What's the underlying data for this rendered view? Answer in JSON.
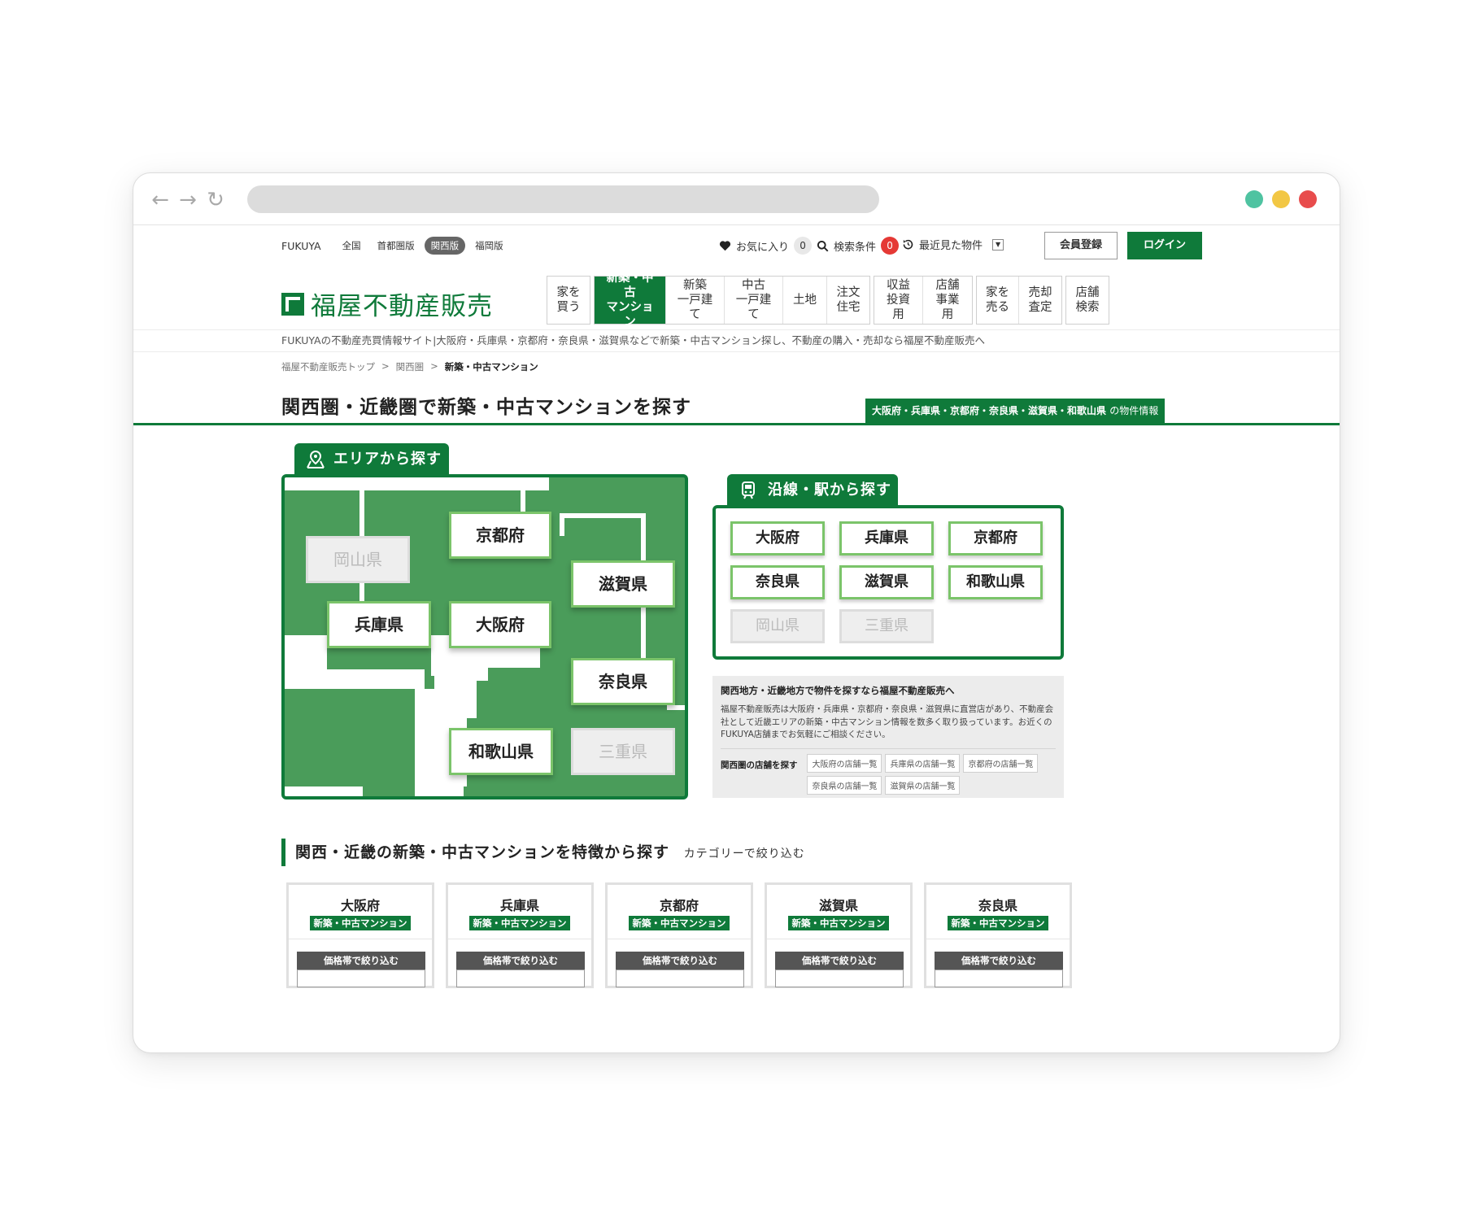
{
  "colors": {
    "brand_green": "#0f7a3a",
    "map_green": "#4a9c5a",
    "button_border": "#7bc46a"
  },
  "browser": {
    "back_icon": "←",
    "forward_icon": "→",
    "reload_icon": "↻",
    "dots": [
      "#4fc3a1",
      "#f2c744",
      "#e84c4c"
    ]
  },
  "topbar": {
    "brand": "FUKUYA",
    "editions": [
      "全国",
      "首都圏版",
      "関西版",
      "福岡版"
    ],
    "favorites_label": "お気に入り",
    "favorites_count": "0",
    "search_conditions_label": "検索条件",
    "search_conditions_count": "0",
    "recent_label": "最近見た物件",
    "member_label": "会員登録",
    "login_label": "ログイン"
  },
  "logo": {
    "text": "福屋不動産販売"
  },
  "gnav": [
    [
      "家を\n買う"
    ],
    [
      "新築・中古\nマンション",
      "新築\n一戸建て",
      "中古\n一戸建て",
      "土地",
      "注文\n住宅"
    ],
    [
      "収益\n投資用",
      "店舗\n事業用"
    ],
    [
      "家を\n売る",
      "売却\n査定"
    ],
    [
      "店舗\n検索"
    ]
  ],
  "tagline": "FUKUYAの不動産売買情報サイト|大阪府・兵庫県・京都府・奈良県・滋賀県などで新築・中古マンション探し、不動産の購入・売却なら福屋不動産販売へ",
  "breadcrumb": [
    "福屋不動産販売トップ",
    ">",
    "関西圏",
    ">",
    "新築・中古マンション"
  ],
  "page_title": "関西圏・近畿圏で新築・中古マンションを探す",
  "pref_tag": {
    "main": "大阪府・兵庫県・京都府・奈良県・滋賀県・和歌山県",
    "suffix": "の物件情報"
  },
  "area": {
    "tab_label": "エリアから探す",
    "prefs": {
      "kyoto": "京都府",
      "okayama": "岡山県",
      "shiga": "滋賀県",
      "hyogo": "兵庫県",
      "osaka": "大阪府",
      "nara": "奈良県",
      "wakayama": "和歌山県",
      "mie": "三重県"
    }
  },
  "line": {
    "tab_label": "沿線・駅から探す",
    "prefs": [
      "大阪府",
      "兵庫県",
      "京都府",
      "奈良県",
      "滋賀県",
      "和歌山県",
      "岡山県",
      "三重県"
    ]
  },
  "info": {
    "title": "関西地方・近畿地方で物件を探すなら福屋不動産販売へ",
    "body": "福屋不動産販売は大阪府・兵庫県・京都府・奈良県・滋賀県に直営店があり、不動産会社として近畿エリアの新築・中古マンション情報を数多く取り扱っています。お近くのFUKUYA店舗までお気軽にご相談ください。",
    "shops_label": "関西圏の店舗を探す",
    "shops": [
      "大阪府の店舗一覧",
      "兵庫県の店舗一覧",
      "京都府の店舗一覧",
      "奈良県の店舗一覧",
      "滋賀県の店舗一覧"
    ]
  },
  "feature": {
    "title": "関西・近畿の新築・中古マンションを特徴から探す",
    "subtitle": "カテゴリーで絞り込む",
    "badge": "新築・中古マンション",
    "price_label": "価格帯で絞り込む",
    "cards": [
      "大阪府",
      "兵庫県",
      "京都府",
      "滋賀県",
      "奈良県"
    ]
  }
}
